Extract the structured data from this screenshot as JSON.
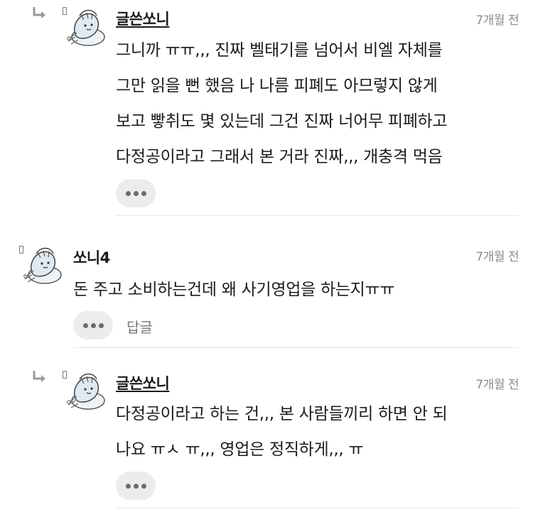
{
  "comments": [
    {
      "author": "글쓴쏘니",
      "time": "7개월 전",
      "lines": [
        "그니까 ㅠㅠ,,, 진짜 벨태기를 넘어서 비엘 자체를",
        "그만 읽을 뻔 했음 나 나름 피폐도 아므렇지 않게",
        "보고 빻취도 몇 있는데 그건 진짜 너어무 피폐하고",
        "다정공이라고 그래서 본 거라 진짜,,, 개충격 먹음"
      ]
    },
    {
      "author": "쏘니4",
      "time": "7개월 전",
      "lines": [
        "돈 주고 소비하는건데 왜 사기영업을 하는지ㅠㅠ"
      ],
      "reply_label": "답글"
    },
    {
      "author": "글쓴쏘니",
      "time": "7개월 전",
      "lines": [
        "다정공이라고 하는 건,,, 본 사람들끼리 하면 안 되",
        "나요 ㅠㅅ ㅠ,,, 영업은 정직하게,,, ㅠ"
      ]
    }
  ]
}
